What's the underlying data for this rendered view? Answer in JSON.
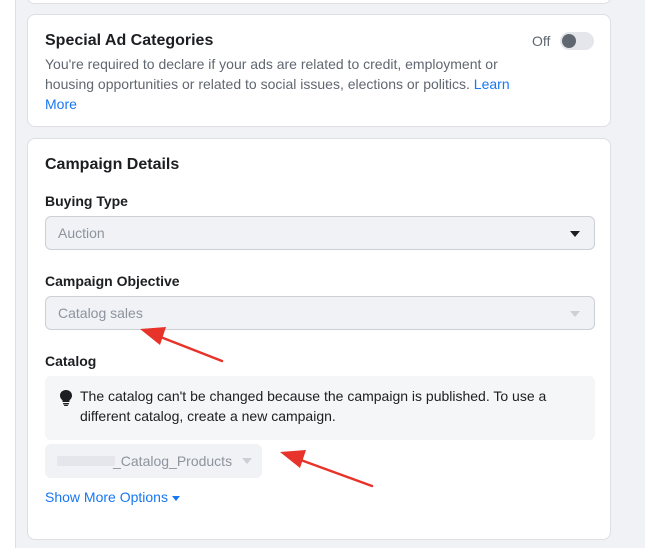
{
  "special_ad_categories": {
    "title": "Special Ad Categories",
    "description": "You're required to declare if your ads are related to credit, employment or housing opportunities or related to social issues, elections or politics.",
    "link": "Learn More",
    "toggle_label": "Off",
    "toggle_on": false
  },
  "campaign_details": {
    "title": "Campaign Details",
    "buying_type": {
      "label": "Buying Type",
      "value": "Auction"
    },
    "objective": {
      "label": "Campaign Objective",
      "value": "Catalog sales"
    },
    "catalog": {
      "label": "Catalog",
      "notice": "The catalog can't be changed because the campaign is published. To use a different catalog, create a new campaign.",
      "selected": "_Catalog_Products"
    },
    "show_more": "Show More Options"
  },
  "colors": {
    "accent": "#1877f2",
    "annotation": "#e8332a"
  },
  "icons": {
    "notice": "lightbulb-icon",
    "dropdown": "chevron-down-icon"
  }
}
